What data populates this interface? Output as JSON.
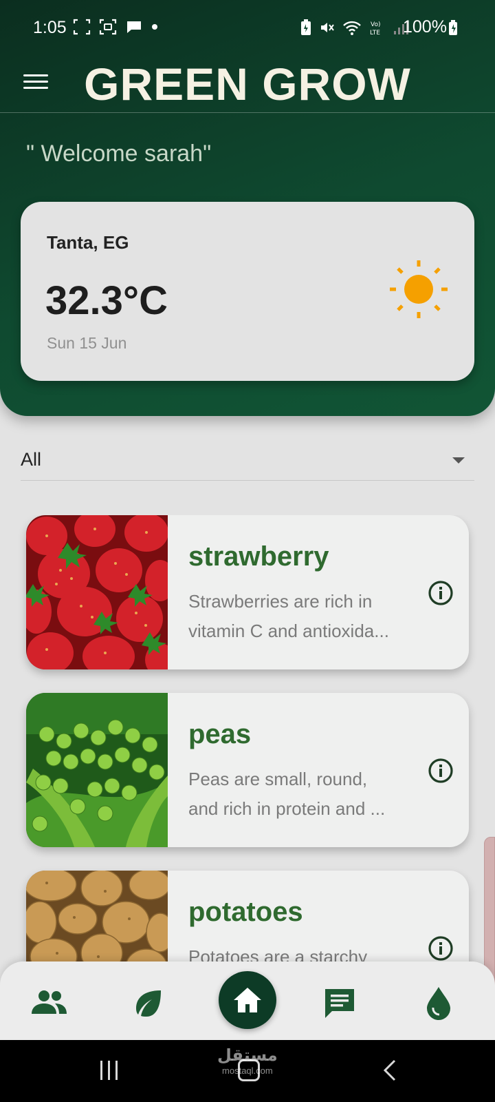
{
  "status_bar": {
    "time": "1:05",
    "battery": "100%",
    "network_label": "LTE"
  },
  "app": {
    "title": "GREEN GROW"
  },
  "welcome_text": "\" Welcome sarah\"",
  "weather": {
    "city": "Tanta, EG",
    "temperature": "32.3°C",
    "date": "Sun 15 Jun",
    "icon": "sun-icon",
    "icon_color": "#f5a000"
  },
  "filter": {
    "selected": "All"
  },
  "crops": [
    {
      "name": "strawberry",
      "desc_line1": "Strawberries are rich in",
      "desc_line2": "vitamin C and antioxida...",
      "image": "strawberries-photo"
    },
    {
      "name": "peas",
      "desc_line1": "Peas are small, round,",
      "desc_line2": "and rich in protein and ...",
      "image": "peas-photo"
    },
    {
      "name": "potatoes",
      "desc_line1": "Potatoes are a starchy",
      "desc_line2": "",
      "image": "potatoes-photo"
    }
  ],
  "bottom_nav": {
    "items": [
      "community-icon",
      "leaf-icon",
      "home-icon",
      "chat-icon",
      "water-drop-icon"
    ],
    "active": "home-icon",
    "accent": "#1e5a34"
  },
  "watermark": {
    "main": "مستقل",
    "sub": "mostaql.com"
  },
  "colors": {
    "header_dark": "#0b2e1f",
    "header_light": "#115535",
    "crop_title": "#2f6a2f",
    "title_text": "#f5f1e3"
  }
}
